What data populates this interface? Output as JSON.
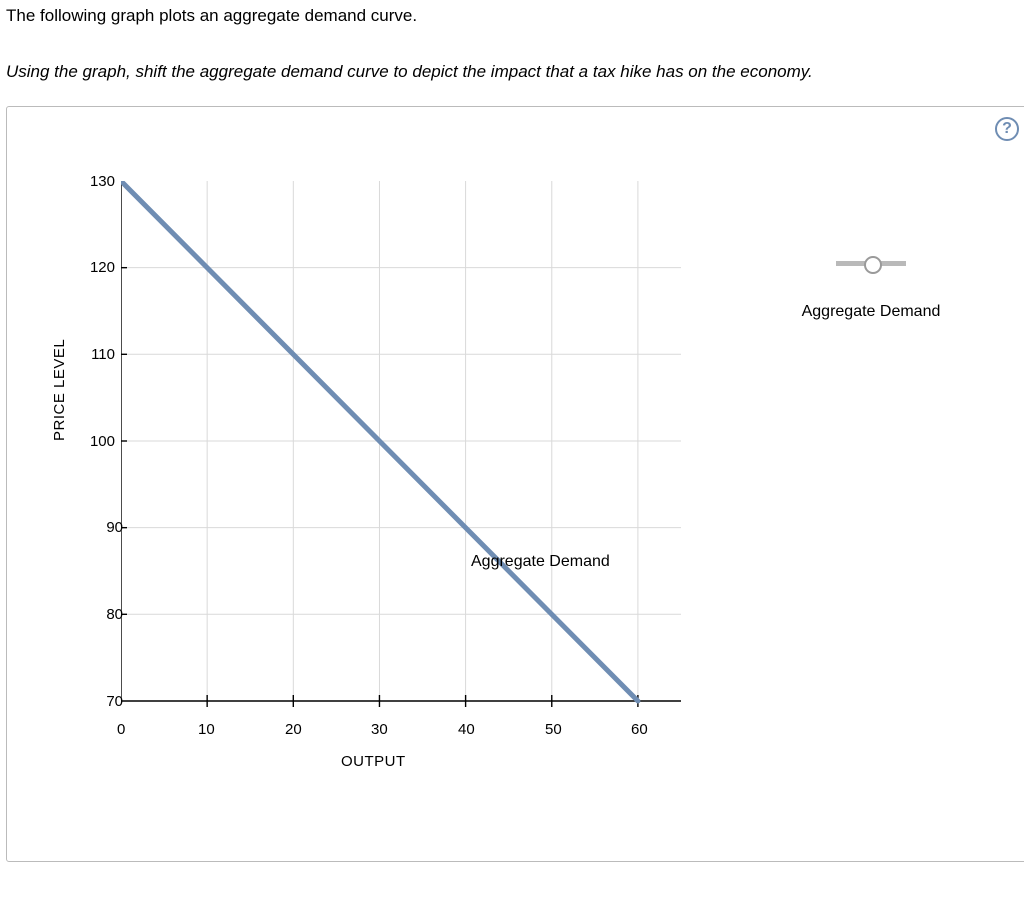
{
  "intro_text": "The following graph plots an aggregate demand curve.",
  "instruction_text": "Using the graph, shift the aggregate demand curve to depict the impact that a tax hike has on the economy.",
  "help_label": "?",
  "legend": {
    "label": "Aggregate Demand"
  },
  "chart_data": {
    "type": "line",
    "xlabel": "OUTPUT",
    "ylabel": "PRICE LEVEL",
    "x_ticks": [
      0,
      10,
      20,
      30,
      40,
      50,
      60
    ],
    "y_ticks": [
      70,
      80,
      90,
      100,
      110,
      120,
      130
    ],
    "xlim": [
      0,
      65
    ],
    "ylim": [
      70,
      130
    ],
    "series": [
      {
        "name": "Aggregate Demand",
        "x": [
          0,
          60
        ],
        "y": [
          130,
          70
        ],
        "color": "#6f8db3",
        "draggable": true
      }
    ],
    "annotations": [
      {
        "text": "Aggregate Demand",
        "x": 41,
        "y": 86
      }
    ]
  }
}
